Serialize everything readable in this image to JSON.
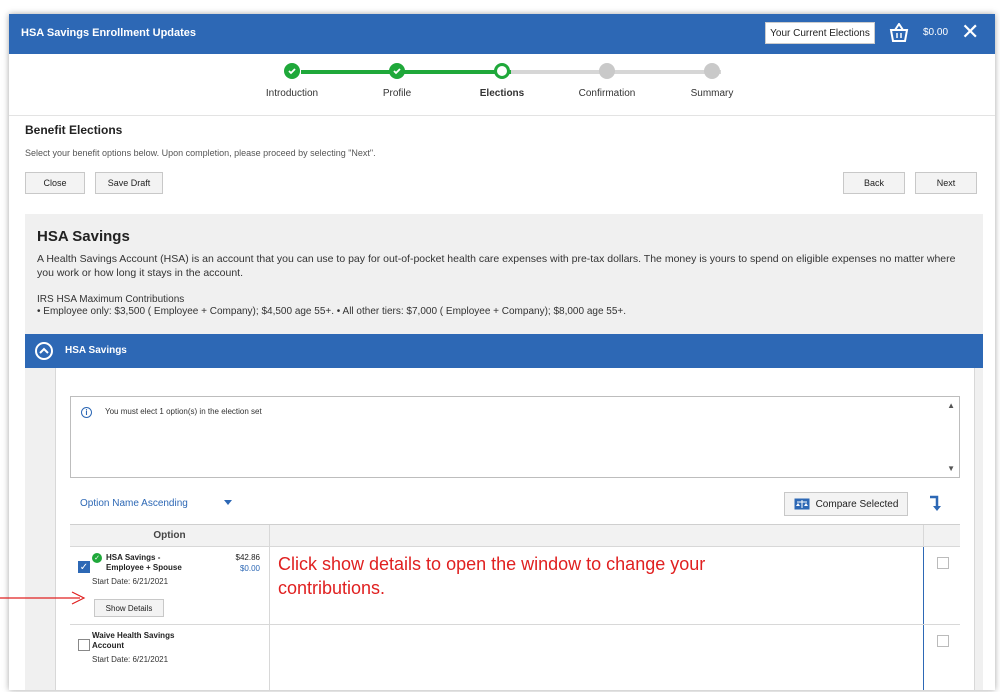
{
  "header": {
    "title": "HSA Savings Enrollment Updates",
    "current_elections_label": "Your Current Elections",
    "cart_total": "$0.00",
    "close_glyph": "✕"
  },
  "stepper": {
    "steps": [
      {
        "label": "Introduction",
        "state": "done"
      },
      {
        "label": "Profile",
        "state": "done"
      },
      {
        "label": "Elections",
        "state": "current"
      },
      {
        "label": "Confirmation",
        "state": "todo"
      },
      {
        "label": "Summary",
        "state": "todo"
      }
    ]
  },
  "benefit": {
    "title": "Benefit Elections",
    "description": "Select your benefit options below. Upon completion, please proceed by selecting \"Next\".",
    "close_label": "Close",
    "save_draft_label": "Save Draft",
    "back_label": "Back",
    "next_label": "Next"
  },
  "hsa": {
    "title": "HSA Savings",
    "description": "A Health Savings Account (HSA) is an account that you can use to pay for out-of-pocket health care expenses with pre-tax dollars. The money is yours to spend on eligible expenses no matter where you work or how long it stays in the account.",
    "irs_title": "IRS HSA Maximum Contributions",
    "irs_text": "• Employee only: $3,500 ( Employee + Company); $4,500 age 55+. • All other tiers: $7,000 ( Employee + Company); $8,000 age 55+."
  },
  "accordion": {
    "title": "HSA Savings"
  },
  "election": {
    "message": "You must elect 1 option(s) in the election set",
    "sort_label": "Option Name Ascending",
    "compare_label": "Compare Selected",
    "column_option": "Option",
    "rows": [
      {
        "name_line1": "HSA Savings -",
        "name_line2": "Employee + Spouse",
        "start_date": "Start Date: 6/21/2021",
        "price1": "$42.86",
        "price2": "$0.00",
        "selected": true,
        "details_label": "Show Details"
      },
      {
        "name_line1": "Waive Health Savings",
        "name_line2": "Account",
        "start_date": "Start Date: 6/21/2021",
        "selected": false
      }
    ]
  },
  "annotation": {
    "text": "Click show details to open the window to change your contributions."
  },
  "colors": {
    "brand_blue": "#2d68b5",
    "done_green": "#1fa83a",
    "annotation_red": "#e02020"
  }
}
